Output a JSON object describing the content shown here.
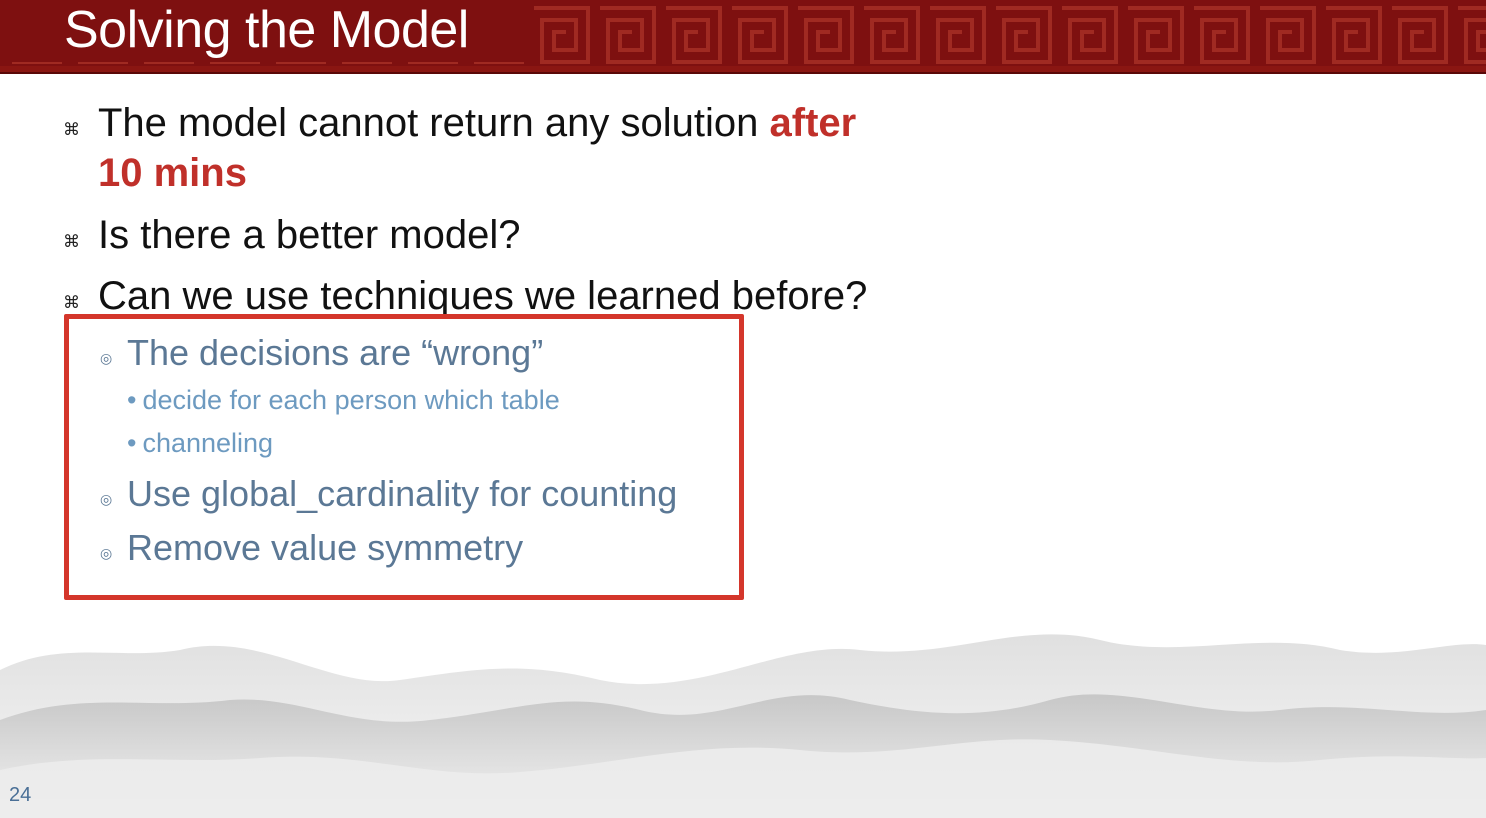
{
  "slide": {
    "title": "Solving the Model",
    "page_number": "24",
    "bullets": {
      "b1_text": "The model cannot return any solution ",
      "b1_highlight_a": "after",
      "b1_highlight_b": "10 mins",
      "b2_text": "Is there a better model?",
      "b3_text": "Can we use techniques we learned before?"
    },
    "sub_bullets": {
      "s1": "The decisions are “wrong”",
      "s1a": "decide for each person which table",
      "s1b": "channeling",
      "s2": "Use global_cardinality for counting",
      "s3": "Remove value symmetry"
    },
    "bullet_glyph": "⌘",
    "sub_bullet_glyph": "◎",
    "subsub_bullet_glyph": "•"
  },
  "colors": {
    "header": "#7e1010",
    "highlight": "#c0302a",
    "sub_text": "#5b7895",
    "subsub_text": "#6d9ac0",
    "box_border": "#d4362b"
  }
}
